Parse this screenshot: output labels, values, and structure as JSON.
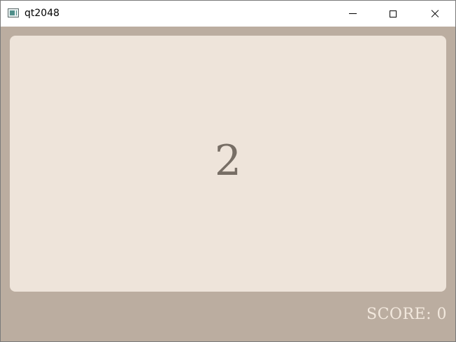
{
  "window": {
    "title": "qt2048",
    "controls": {
      "minimize_icon": "minimize-icon",
      "maximize_icon": "maximize-icon",
      "close_icon": "close-icon"
    }
  },
  "game": {
    "tile_value": "2",
    "score_text": "SCORE: 0"
  },
  "colors": {
    "background": "#bbada0",
    "tile": "#eee4da",
    "tile_text": "#776e65",
    "score_text": "#f2e8dd"
  }
}
